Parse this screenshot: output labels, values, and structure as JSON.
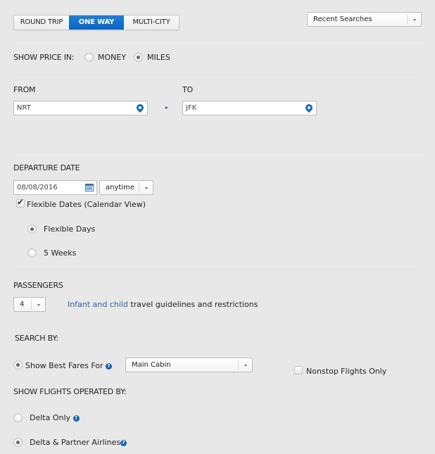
{
  "trip_type": {
    "options": [
      "ROUND TRIP",
      "ONE WAY",
      "MULTI-CITY"
    ],
    "selected": "ONE WAY"
  },
  "recent_searches": {
    "label": "Recent Searches"
  },
  "price": {
    "label": "SHOW PRICE IN:",
    "options": [
      "MONEY",
      "MILES"
    ],
    "selected": "MILES"
  },
  "route": {
    "from_label": "FROM",
    "from_value": "NRT",
    "to_label": "TO",
    "to_value": "JFK"
  },
  "departure": {
    "label": "DEPARTURE DATE",
    "date": "08/08/2016",
    "time": "anytime",
    "flexible_label": "Flexible Dates (Calendar View)",
    "flexible_checked": true,
    "flex_options": [
      "Flexible Days",
      "5 Weeks"
    ],
    "flex_selected": "Flexible Days"
  },
  "passengers": {
    "label": "PASSENGERS",
    "count": "4",
    "link_text": "Infant and child",
    "link_suffix": " travel guidelines and restrictions"
  },
  "search_by": {
    "label": "SEARCH BY:",
    "best_fares_label": "Show Best Fares For",
    "cabin": "Main Cabin",
    "nonstop_label": "Nonstop Flights Only",
    "nonstop_checked": false
  },
  "operated_by": {
    "label": "SHOW FLIGHTS OPERATED BY:",
    "options": [
      "Delta Only",
      "Delta & Partner Airlines"
    ],
    "selected": "Delta & Partner Airlines"
  },
  "colors": {
    "accent": "#0b63c0",
    "link": "#2a63a6",
    "background": "#e8e8e8"
  }
}
